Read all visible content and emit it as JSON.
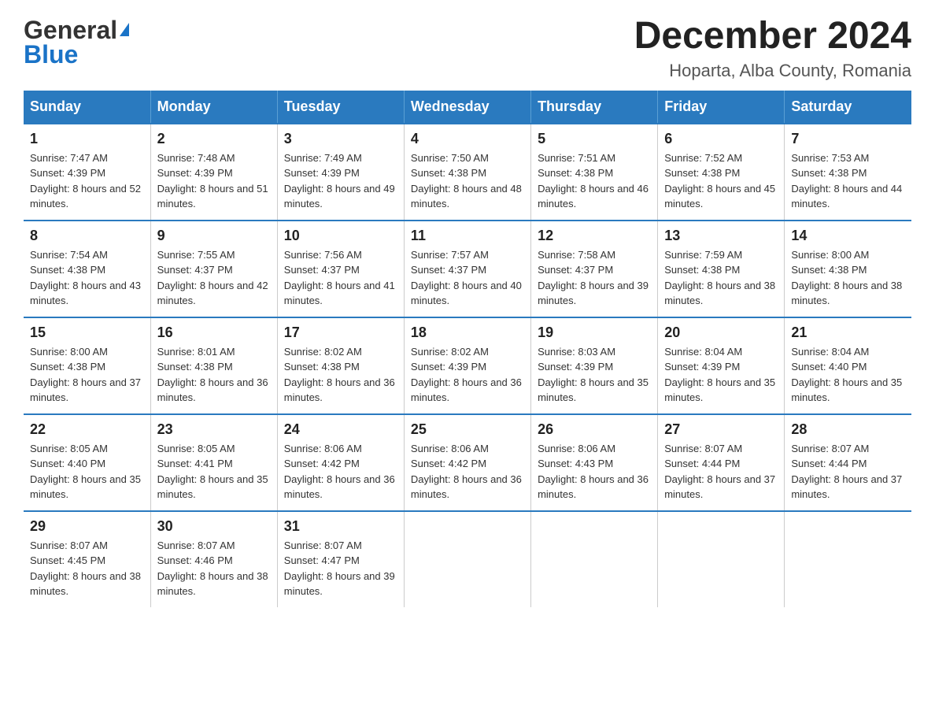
{
  "logo": {
    "general": "General",
    "blue": "Blue"
  },
  "title": {
    "month": "December 2024",
    "location": "Hoparta, Alba County, Romania"
  },
  "weekdays": [
    "Sunday",
    "Monday",
    "Tuesday",
    "Wednesday",
    "Thursday",
    "Friday",
    "Saturday"
  ],
  "weeks": [
    [
      {
        "day": "1",
        "sunrise": "7:47 AM",
        "sunset": "4:39 PM",
        "daylight": "8 hours and 52 minutes."
      },
      {
        "day": "2",
        "sunrise": "7:48 AM",
        "sunset": "4:39 PM",
        "daylight": "8 hours and 51 minutes."
      },
      {
        "day": "3",
        "sunrise": "7:49 AM",
        "sunset": "4:39 PM",
        "daylight": "8 hours and 49 minutes."
      },
      {
        "day": "4",
        "sunrise": "7:50 AM",
        "sunset": "4:38 PM",
        "daylight": "8 hours and 48 minutes."
      },
      {
        "day": "5",
        "sunrise": "7:51 AM",
        "sunset": "4:38 PM",
        "daylight": "8 hours and 46 minutes."
      },
      {
        "day": "6",
        "sunrise": "7:52 AM",
        "sunset": "4:38 PM",
        "daylight": "8 hours and 45 minutes."
      },
      {
        "day": "7",
        "sunrise": "7:53 AM",
        "sunset": "4:38 PM",
        "daylight": "8 hours and 44 minutes."
      }
    ],
    [
      {
        "day": "8",
        "sunrise": "7:54 AM",
        "sunset": "4:38 PM",
        "daylight": "8 hours and 43 minutes."
      },
      {
        "day": "9",
        "sunrise": "7:55 AM",
        "sunset": "4:37 PM",
        "daylight": "8 hours and 42 minutes."
      },
      {
        "day": "10",
        "sunrise": "7:56 AM",
        "sunset": "4:37 PM",
        "daylight": "8 hours and 41 minutes."
      },
      {
        "day": "11",
        "sunrise": "7:57 AM",
        "sunset": "4:37 PM",
        "daylight": "8 hours and 40 minutes."
      },
      {
        "day": "12",
        "sunrise": "7:58 AM",
        "sunset": "4:37 PM",
        "daylight": "8 hours and 39 minutes."
      },
      {
        "day": "13",
        "sunrise": "7:59 AM",
        "sunset": "4:38 PM",
        "daylight": "8 hours and 38 minutes."
      },
      {
        "day": "14",
        "sunrise": "8:00 AM",
        "sunset": "4:38 PM",
        "daylight": "8 hours and 38 minutes."
      }
    ],
    [
      {
        "day": "15",
        "sunrise": "8:00 AM",
        "sunset": "4:38 PM",
        "daylight": "8 hours and 37 minutes."
      },
      {
        "day": "16",
        "sunrise": "8:01 AM",
        "sunset": "4:38 PM",
        "daylight": "8 hours and 36 minutes."
      },
      {
        "day": "17",
        "sunrise": "8:02 AM",
        "sunset": "4:38 PM",
        "daylight": "8 hours and 36 minutes."
      },
      {
        "day": "18",
        "sunrise": "8:02 AM",
        "sunset": "4:39 PM",
        "daylight": "8 hours and 36 minutes."
      },
      {
        "day": "19",
        "sunrise": "8:03 AM",
        "sunset": "4:39 PM",
        "daylight": "8 hours and 35 minutes."
      },
      {
        "day": "20",
        "sunrise": "8:04 AM",
        "sunset": "4:39 PM",
        "daylight": "8 hours and 35 minutes."
      },
      {
        "day": "21",
        "sunrise": "8:04 AM",
        "sunset": "4:40 PM",
        "daylight": "8 hours and 35 minutes."
      }
    ],
    [
      {
        "day": "22",
        "sunrise": "8:05 AM",
        "sunset": "4:40 PM",
        "daylight": "8 hours and 35 minutes."
      },
      {
        "day": "23",
        "sunrise": "8:05 AM",
        "sunset": "4:41 PM",
        "daylight": "8 hours and 35 minutes."
      },
      {
        "day": "24",
        "sunrise": "8:06 AM",
        "sunset": "4:42 PM",
        "daylight": "8 hours and 36 minutes."
      },
      {
        "day": "25",
        "sunrise": "8:06 AM",
        "sunset": "4:42 PM",
        "daylight": "8 hours and 36 minutes."
      },
      {
        "day": "26",
        "sunrise": "8:06 AM",
        "sunset": "4:43 PM",
        "daylight": "8 hours and 36 minutes."
      },
      {
        "day": "27",
        "sunrise": "8:07 AM",
        "sunset": "4:44 PM",
        "daylight": "8 hours and 37 minutes."
      },
      {
        "day": "28",
        "sunrise": "8:07 AM",
        "sunset": "4:44 PM",
        "daylight": "8 hours and 37 minutes."
      }
    ],
    [
      {
        "day": "29",
        "sunrise": "8:07 AM",
        "sunset": "4:45 PM",
        "daylight": "8 hours and 38 minutes."
      },
      {
        "day": "30",
        "sunrise": "8:07 AM",
        "sunset": "4:46 PM",
        "daylight": "8 hours and 38 minutes."
      },
      {
        "day": "31",
        "sunrise": "8:07 AM",
        "sunset": "4:47 PM",
        "daylight": "8 hours and 39 minutes."
      },
      null,
      null,
      null,
      null
    ]
  ],
  "labels": {
    "sunrise": "Sunrise:",
    "sunset": "Sunset:",
    "daylight": "Daylight:"
  }
}
